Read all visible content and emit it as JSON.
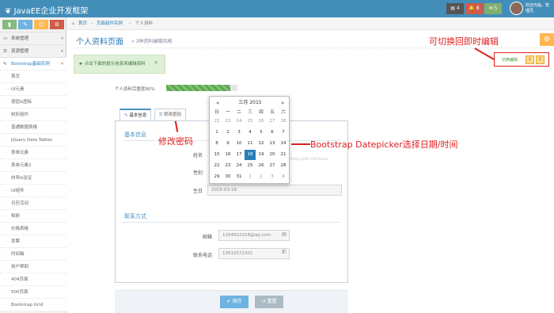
{
  "app": {
    "brand": "JavaEE企业开发框架"
  },
  "topbar": {
    "badges": [
      {
        "name": "tasks-badge",
        "icon": "tasks-icon",
        "glyph": "▤",
        "count": "4",
        "color": "#555555"
      },
      {
        "name": "notifications-badge",
        "icon": "bell-icon",
        "glyph": "🔔",
        "count": "8",
        "color": "#d15b47"
      },
      {
        "name": "messages-badge",
        "icon": "envelope-icon",
        "glyph": "✉",
        "count": "5",
        "color": "#82af6f"
      }
    ],
    "user_name": "欢迎光临，管理员"
  },
  "shortcuts": [
    {
      "icon": "chart-icon",
      "glyph": "▮",
      "color": "#87b87f"
    },
    {
      "icon": "pencil-icon",
      "glyph": "✎",
      "color": "#6fb3e0"
    },
    {
      "icon": "group-icon",
      "glyph": "☺",
      "color": "#ffb752"
    },
    {
      "icon": "cogs-icon",
      "glyph": "⚙",
      "color": "#d15b47"
    }
  ],
  "sidebar": {
    "menus": [
      {
        "label": "系统管理",
        "icon": "desktop-icon",
        "glyph": "▭"
      },
      {
        "label": "资源管理",
        "icon": "list-icon",
        "glyph": "☰"
      },
      {
        "label": "Bootstrap基础实例",
        "icon": "edit-icon",
        "glyph": "✎"
      }
    ],
    "sub_items": [
      "首页",
      "UI元素",
      "按钮&图标",
      "树形组件",
      "普通数据表格",
      "jQuery Data Tables",
      "表单元素",
      "表单元素2",
      "向导&验证",
      "UI组件",
      "日历活动",
      "相册",
      "价格表格",
      "发票",
      "时间轴",
      "用户帮助",
      "404页面",
      "500页面",
      "Bootstrap Grid"
    ]
  },
  "breadcrumb": {
    "home": "首页",
    "parent": "页面组件实例",
    "current": "个人资料"
  },
  "page": {
    "title": "个人资料页面",
    "subtitle": "» 3种资料编辑风格"
  },
  "alert": {
    "text": "点击下面的提示信息来编辑资料"
  },
  "annotations": {
    "toggle": "可切换回即时编辑",
    "password": "修改密码",
    "datepicker": "Bootstrap Datepicker选择日期/时间"
  },
  "toggle": {
    "label": "切换编辑",
    "btn1": "1",
    "btn2": "2"
  },
  "profile": {
    "completeness_label": "个人资料完整度90%",
    "completeness": 0.9
  },
  "tabs": [
    {
      "label": "基本信息",
      "icon": "edit-icon"
    },
    {
      "label": "修改密码",
      "icon": "key-icon"
    }
  ],
  "form": {
    "basic_title": "基本信息",
    "contact_title": "联系方式",
    "name_label": "姓名",
    "gender_label": "性别",
    "birthday_label": "生日",
    "birthday_value": "2015-03-18",
    "email_label": "邮箱",
    "email_value": "1104922318@qq.com",
    "phone_label": "联系电话",
    "phone_value": "13515572301",
    "watermark": "http://blog.csdn.net/xxxx"
  },
  "buttons": {
    "save": "保存",
    "reset": "重置"
  },
  "datepicker": {
    "month_label": "三月 2015",
    "prev": "«",
    "next": "»",
    "dow": [
      "日",
      "一",
      "二",
      "三",
      "四",
      "五",
      "六"
    ],
    "days": [
      "22",
      "23",
      "24",
      "25",
      "26",
      "27",
      "28",
      "1",
      "2",
      "3",
      "4",
      "5",
      "6",
      "7",
      "8",
      "9",
      "10",
      "11",
      "12",
      "13",
      "14",
      "15",
      "16",
      "17",
      "18",
      "19",
      "20",
      "21",
      "22",
      "23",
      "24",
      "25",
      "26",
      "27",
      "28",
      "29",
      "30",
      "31",
      "1",
      "2",
      "3",
      "4"
    ],
    "selected_index": 24,
    "first_index": 7,
    "last_index": 37
  }
}
